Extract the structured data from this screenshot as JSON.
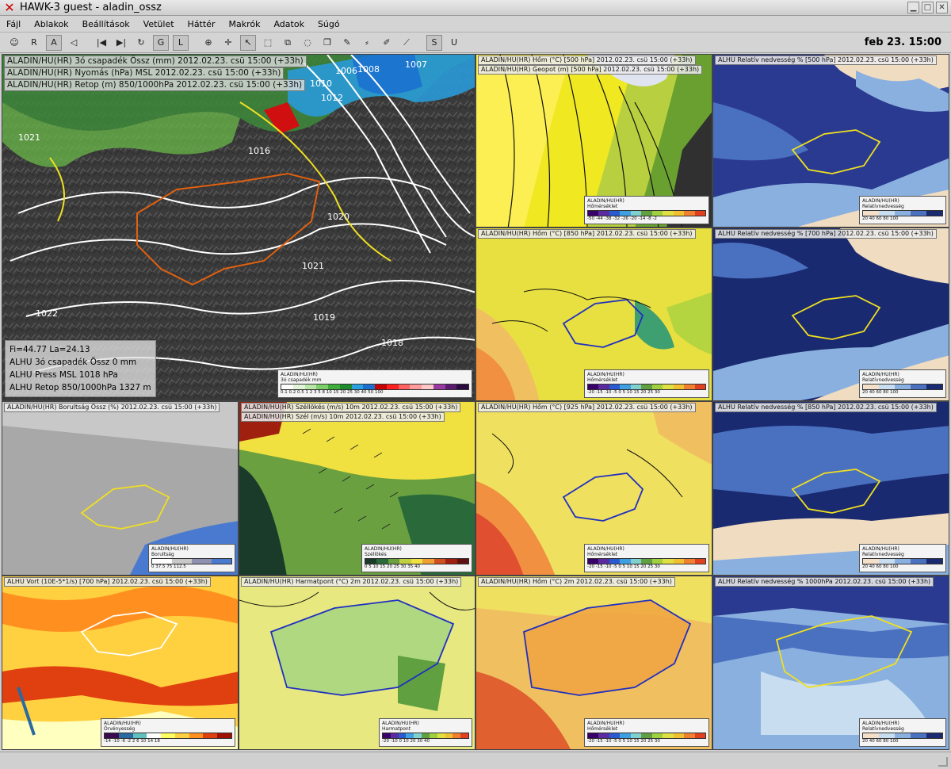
{
  "window": {
    "title": "HAWK-3   guest - aladin_ossz"
  },
  "menu": [
    "Fájl",
    "Ablakok",
    "Beállítások",
    "Vetület",
    "Háttér",
    "Makrók",
    "Adatok",
    "Súgó"
  ],
  "toolbar": {
    "r_label": "R",
    "a_label": "A",
    "g_label": "G",
    "l_label": "L",
    "s_label": "S",
    "u_label": "U",
    "datetime": "feb 23. 15:00"
  },
  "panels": {
    "main": {
      "line1": "ALADIN/HU(HR) 3ó csapadék Össz (mm) 2012.02.23. csü 15:00 (+33h)",
      "line2": "ALADIN/HU(HR) Nyomás (hPa) MSL 2012.02.23. csü 15:00 (+33h)",
      "line3": "ALADIN/HU(HR) Retop (m) 850/1000hPa 2012.02.23. csü 15:00 (+33h)",
      "info1": "Fi=44.77 La=24.13",
      "info2": "ALHU 3ó csapadék Össz   0 mm",
      "info3": "ALHU Press MSL   1018 hPa",
      "info4": "ALHU Retop 850/1000hPa   1327 m",
      "isobars": [
        "1021",
        "1020",
        "1022",
        "1021",
        "1019",
        "1018",
        "1016",
        "1012",
        "1008",
        "1007",
        "1006",
        "1010"
      ],
      "legend_title": "ALADIN/HU(HR)",
      "legend_sub": "3ó csapadék mm",
      "legend_ticks": "0.1 0.2 0.5  1   2   3   5   8  10  15  20  25  30  40  50 100"
    },
    "p1": {
      "line1": "ALADIN/HU(HR) Hőm (°C) [500 hPa] 2012.02.23. csü 15:00 (+33h)",
      "line2": "ALADIN/HU(HR) Geopot (m) [500 hPa] 2012.02.23. csü 15:00 (+33h)",
      "legend_title": "ALADIN/HU(HR)",
      "legend_sub": "Hőmérséklet",
      "legend_ticks": "-50 -44 -38 -32 -26 -20 -14 -8 -2"
    },
    "p2": {
      "line1": "ALHU Relatív nedvesség % [500 hPa] 2012.02.23. csü 15:00 (+33h)",
      "legend_title": "ALADIN/HU(HR)",
      "legend_sub": "Relatívnedvesség",
      "legend_ticks": "20  40  60  80  100"
    },
    "p3": {
      "line1": "ALADIN/HU(HR) Hőm (°C) [850 hPa] 2012.02.23. csü 15:00 (+33h)",
      "legend_title": "ALADIN/HU(HR)",
      "legend_sub": "Hőmérséklet",
      "legend_ticks": "-20 -15 -10 -5  0  5 10 15 20 25 30"
    },
    "p4": {
      "line1": "ALHU Relatív nedvesség % [700 hPa] 2012.02.23. csü 15:00 (+33h)",
      "legend_title": "ALADIN/HU(HR)",
      "legend_sub": "Relatívnedvesség",
      "legend_ticks": "20  40  60  80  100"
    },
    "p5": {
      "line1": "ALADIN/HU(HR) Borultság Össz (%) 2012.02.23. csü 15:00 (+33h)",
      "legend_title": "ALADIN/HU(HR)",
      "legend_sub": "Borultság",
      "legend_ticks": "0   37.5   75   112.5"
    },
    "p6": {
      "line1": "ALADIN/HU(HR) Széllökés (m/s) 10m 2012.02.23. csü 15:00 (+33h)",
      "line2": "ALADIN/HU(HR) Szél (m/s) 10m 2012.02.23. csü 15:00 (+33h)",
      "legend_title": "ALADIN/HU(HR)",
      "legend_sub": "Széllökés",
      "legend_ticks": "0  5 10 15 20 25 30 35 40"
    },
    "p7": {
      "line1": "ALADIN/HU(HR) Hőm (°C) [925 hPa] 2012.02.23. csü 15:00 (+33h)",
      "legend_title": "ALADIN/HU(HR)",
      "legend_sub": "Hőmérséklet",
      "legend_ticks": "-20 -15 -10 -5  0  5 10 15 20 25 30"
    },
    "p8": {
      "line1": "ALHU Relatív nedvesség % [850 hPa] 2012.02.23. csü 15:00 (+33h)",
      "legend_title": "ALADIN/HU(HR)",
      "legend_sub": "Relatívnedvesség",
      "legend_ticks": "20  40  60  80  100"
    },
    "p9": {
      "line1": "ALHU Vort (10E-5*1/s) [700 hPa] 2012.02.23. csü 15:00 (+33h)",
      "legend_title": "ALADIN/HU(HR)",
      "legend_sub": "Örvényesség",
      "legend_ticks": "-14 -10 -6 -2  2  6 10 14 18"
    },
    "p10": {
      "line1": "ALADIN/HU(HR) Harmatpont (°C) 2m 2012.02.23. csü 15:00 (+33h)",
      "legend_title": "ALADIN/HU(HR)",
      "legend_sub": "Harmatpont",
      "legend_ticks": "-20 -10  0 10 20 30 40"
    },
    "p11": {
      "line1": "ALADIN/HU(HR) Hőm (°C) 2m 2012.02.23. csü 15:00 (+33h)",
      "legend_title": "ALADIN/HU(HR)",
      "legend_sub": "Hőmérséklet",
      "legend_ticks": "-20 -15 -10 -5  0  5 10 15 20 25 30"
    },
    "p12": {
      "line1": "ALHU Relatív nedvesség % 1000hPa 2012.02.23. csü 15:00 (+33h)",
      "legend_title": "ALADIN/HU(HR)",
      "legend_sub": "Relatívnedvesség",
      "legend_ticks": "20  40  60  80  100"
    }
  },
  "colors": {
    "precip_scale": [
      "#ffffff",
      "#e0f5d8",
      "#b8e6a8",
      "#7ccf6a",
      "#3fae3d",
      "#1c8a2d",
      "#2aa0e0",
      "#1a6fd0",
      "#c80000",
      "#ff2020",
      "#ff6060",
      "#ff9a9a",
      "#ffc8c8",
      "#9a3aa0",
      "#5a1a70",
      "#2a0a40"
    ],
    "temp_scale": [
      "#3a006a",
      "#5a2aa0",
      "#2a5ad0",
      "#3ea0e0",
      "#80d0d0",
      "#60a040",
      "#a0d040",
      "#e0e040",
      "#f0c030",
      "#f08030",
      "#e04020"
    ],
    "rh_scale": [
      "#f4e0c8",
      "#c8ddf0",
      "#8ab0e0",
      "#4a70c0",
      "#1a2a70"
    ],
    "gust_scale": [
      "#1a3a2a",
      "#2a6a3a",
      "#6aa040",
      "#c0d040",
      "#f0e040",
      "#f0a030",
      "#d05020",
      "#a02010",
      "#601010"
    ],
    "vort_scale": [
      "#3a0a50",
      "#2a6aa0",
      "#60c0c0",
      "#ffffff",
      "#ffff60",
      "#ffd040",
      "#ff9020",
      "#e04010",
      "#a01000"
    ],
    "cloud_scale": [
      "#ffffff",
      "#c8c8c8",
      "#9090b0",
      "#4a7ad0"
    ]
  }
}
